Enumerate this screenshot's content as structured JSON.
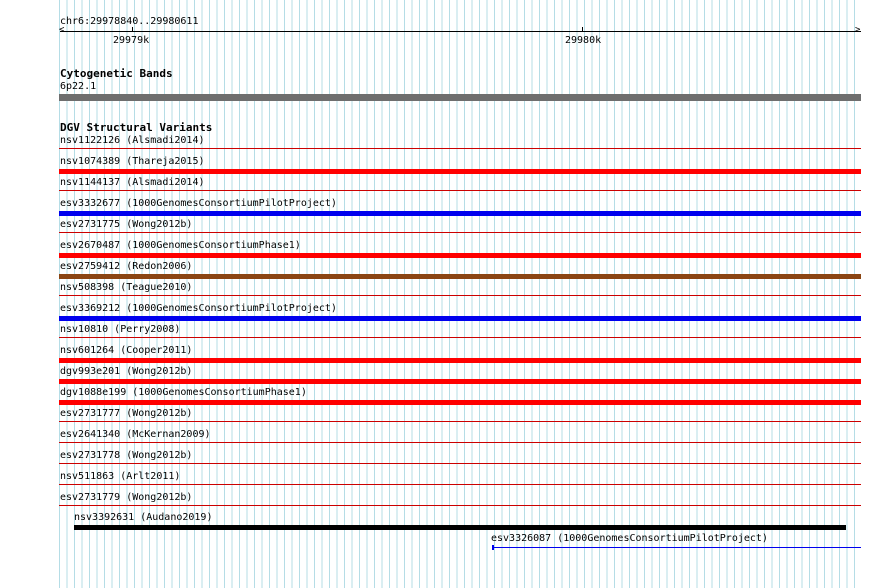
{
  "ruler": {
    "range_label": "chr6:29978840..29980611",
    "tick_labels": [
      "29979k",
      "29980k"
    ]
  },
  "cytoband": {
    "title": "Cytogenetic Bands",
    "band_label": "6p22.1",
    "color": "#6e6e6e"
  },
  "dgv": {
    "title": "DGV Structural Variants",
    "rows": [
      {
        "label": "nsv1122126 (Alsmadi2014)",
        "bar": "none"
      },
      {
        "label": "nsv1074389 (Thareja2015)",
        "bar": "red"
      },
      {
        "label": "nsv1144137 (Alsmadi2014)",
        "bar": "none"
      },
      {
        "label": "esv3332677 (1000GenomesConsortiumPilotProject)",
        "bar": "blue"
      },
      {
        "label": "esv2731775 (Wong2012b)",
        "bar": "none"
      },
      {
        "label": "esv2670487 (1000GenomesConsortiumPhase1)",
        "bar": "red"
      },
      {
        "label": "esv2759412 (Redon2006)",
        "bar": "brown"
      },
      {
        "label": "nsv508398 (Teague2010)",
        "bar": "none"
      },
      {
        "label": "esv3369212 (1000GenomesConsortiumPilotProject)",
        "bar": "blue"
      },
      {
        "label": "nsv10810 (Perry2008)",
        "bar": "none"
      },
      {
        "label": "nsv601264 (Cooper2011)",
        "bar": "red"
      },
      {
        "label": "dgv993e201 (Wong2012b)",
        "bar": "red"
      },
      {
        "label": "dgv1088e199 (1000GenomesConsortiumPhase1)",
        "bar": "red"
      },
      {
        "label": "esv2731777 (Wong2012b)",
        "bar": "none"
      },
      {
        "label": "esv2641340 (McKernan2009)",
        "bar": "none"
      },
      {
        "label": "esv2731778 (Wong2012b)",
        "bar": "none"
      },
      {
        "label": "nsv511863 (Arlt2011)",
        "bar": "none"
      },
      {
        "label": "esv2731779 (Wong2012b)",
        "bar": "none"
      }
    ],
    "extra": [
      {
        "label": "nsv3392631 (Audano2019)",
        "color": "black"
      },
      {
        "label": "esv3326087 (1000GenomesConsortiumPilotProject)",
        "color": "blue"
      }
    ]
  },
  "colors": {
    "red": "#ff0000",
    "blue": "#0000ee",
    "brown": "#8b4513",
    "black": "#000000",
    "row_line": "#cc0000",
    "grid": "#b5dde6"
  }
}
